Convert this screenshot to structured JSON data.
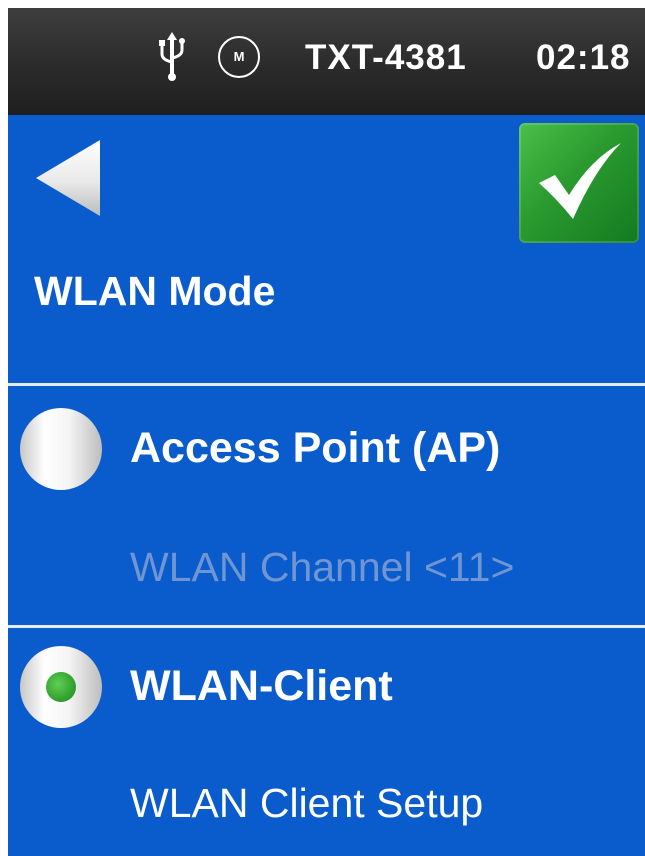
{
  "statusbar": {
    "icons": [
      "usb-icon",
      "m-icon"
    ],
    "m_icon_letter": "M",
    "device_name": "TXT-4381",
    "time": "02:18"
  },
  "header": {
    "back_icon": "left-triangle-icon",
    "confirm_icon": "checkmark-icon",
    "title": "WLAN Mode"
  },
  "options": [
    {
      "label": "Access Point (AP)",
      "selected": false,
      "sub_item": "WLAN Channel <11>",
      "sub_item_enabled": false
    },
    {
      "label": "WLAN-Client",
      "selected": true,
      "sub_item": "WLAN Client Setup",
      "sub_item_enabled": true
    }
  ],
  "colors": {
    "background": "#0a5bcc",
    "statusbar": "#2b2b2b",
    "confirm_green": "#2a9a2f",
    "disabled_text": "#6f95d3",
    "radio_dot": "#3aae35"
  }
}
